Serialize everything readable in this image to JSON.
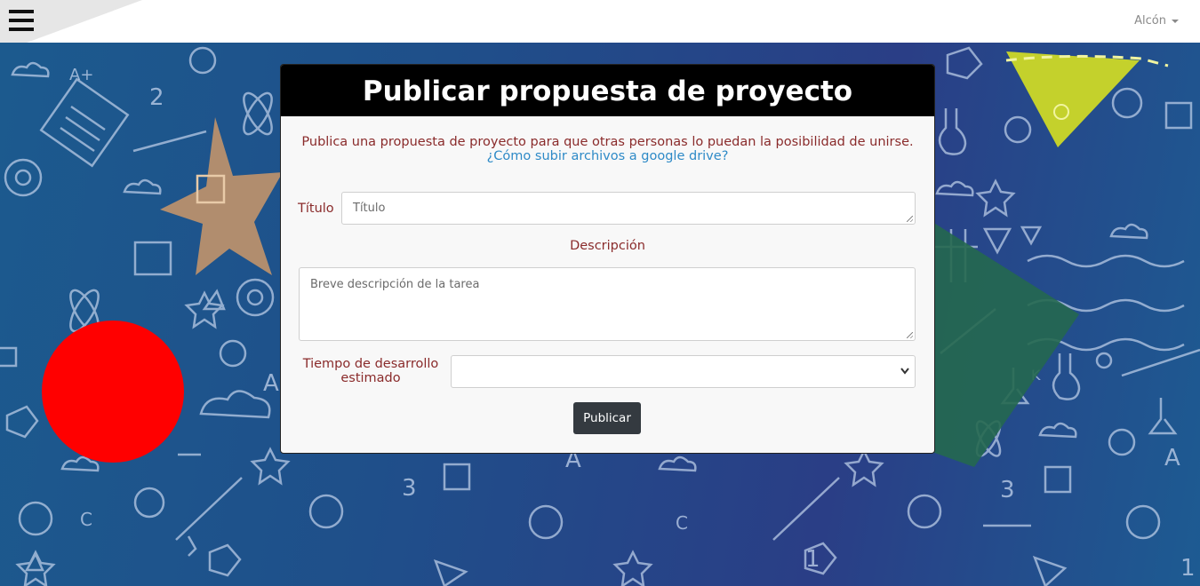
{
  "navbar": {
    "user_label": "Alcón"
  },
  "card": {
    "title": "Publicar propuesta de proyecto",
    "intro": "Publica una propuesta de proyecto para que otras personas lo puedan la posibilidad de unirse.",
    "help_link": "¿Cómo subir archivos a google drive?",
    "title_label": "Título",
    "title_placeholder": "Título",
    "description_label": "Descripción",
    "description_placeholder": "Breve descripción de la tarea",
    "time_label_line1": "Tiempo de desarrollo",
    "time_label_line2": "estimado",
    "time_value": "",
    "submit_label": "Publicar"
  },
  "icons": [
    "hamburger-icon",
    "caret-down-icon",
    "chevron-down-icon"
  ],
  "colors": {
    "header_bg": "#000000",
    "label_color": "#8a2b2b",
    "link_color": "#2e8ac7",
    "button_bg": "#343a40",
    "background": "#1d4f86"
  }
}
